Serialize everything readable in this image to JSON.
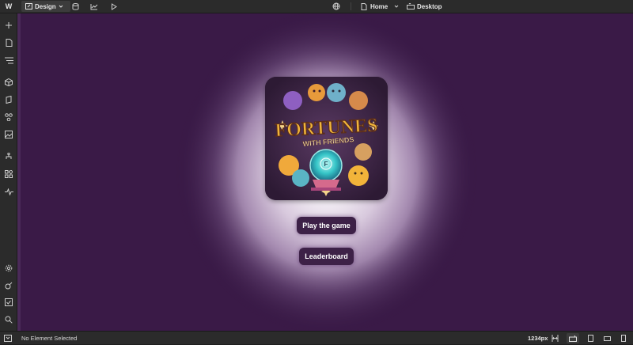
{
  "topbar": {
    "logo": "W",
    "mode_label": "Design",
    "page_label": "Home",
    "breakpoint_label": "Desktop"
  },
  "card": {
    "title_main": "FORTUNES",
    "title_sub": "WITH FRIENDS",
    "orb_letter": "F",
    "colors": {
      "bg": "#3a2540",
      "title": "#f0b53a",
      "orb": "#36c6c8"
    }
  },
  "buttons": {
    "play_label": "Play the game",
    "leaderboard_label": "Leaderboard"
  },
  "status": {
    "selection_text": "No Element Selected",
    "width_value": "1234px"
  },
  "colors": {
    "canvas_bg": "#3a1a47",
    "button_bg": "#3d2147",
    "chrome_bg": "#2b2b2b"
  }
}
